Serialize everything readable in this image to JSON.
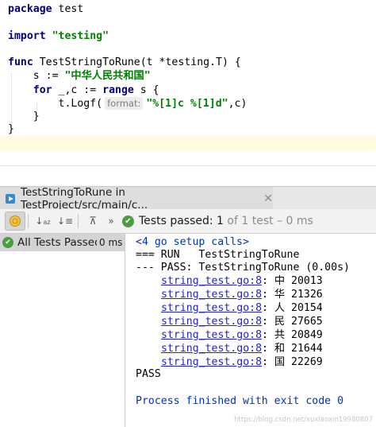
{
  "editor": {
    "line1": {
      "kw": "package",
      "rest": " test"
    },
    "line2": {
      "kw": "import",
      "str": "\"testing\""
    },
    "line3": {
      "kw": "func",
      "rest": " TestStringToRune(t *testing.T) {"
    },
    "line4": {
      "indent": "    ",
      "rest": "s := ",
      "str": "\"中华人民共和国\""
    },
    "line5": {
      "indent": "    ",
      "kw1": "for",
      "mid": " _,c := ",
      "kw2": "range",
      "rest": " s {"
    },
    "line6": {
      "indent": "        ",
      "rest": "t.Logf(",
      "hint": "format:",
      "str": "\"%[1]c %[1]d\"",
      "tail": ",c)"
    },
    "line7": {
      "text": "    }"
    },
    "line8": {
      "text": "}"
    }
  },
  "run_tab": {
    "label": "TestStringToRune in TestProject/src/main/c...",
    "close_icon": "close-icon"
  },
  "toolbar": {
    "status_passed": "Tests passed: ",
    "status_count": "1",
    "status_rest": " of 1 test – 0 ms",
    "icons": [
      "toggle-run-icon",
      "sort-alpha-icon",
      "sort-duration-icon",
      "collapse-icon",
      "more-icon",
      "check-icon"
    ]
  },
  "tree": {
    "row_label": "All Tests Passed",
    "row_duration": "0 ms"
  },
  "console": {
    "setup": "<4 go setup calls>",
    "run": "=== RUN   TestStringToRune",
    "pass": "--- PASS: TestStringToRune (0.00s)",
    "logs": [
      {
        "link": "string_test.go:8",
        "text": ": 中 20013"
      },
      {
        "link": "string_test.go:8",
        "text": ": 华 21326"
      },
      {
        "link": "string_test.go:8",
        "text": ": 人 20154"
      },
      {
        "link": "string_test.go:8",
        "text": ": 民 27665"
      },
      {
        "link": "string_test.go:8",
        "text": ": 共 20849"
      },
      {
        "link": "string_test.go:8",
        "text": ": 和 21644"
      },
      {
        "link": "string_test.go:8",
        "text": ": 国 22269"
      }
    ],
    "result": "PASS",
    "finished": "Process finished with exit code 0",
    "watermark": "https://blog.csdn.net/xuxiaoxin19980807"
  },
  "colors": {
    "keyword": "#000080",
    "string": "#008000",
    "pass_green": "#4a9d3f",
    "link_blue": "#2323c8",
    "caret_line": "#fffbdc"
  }
}
